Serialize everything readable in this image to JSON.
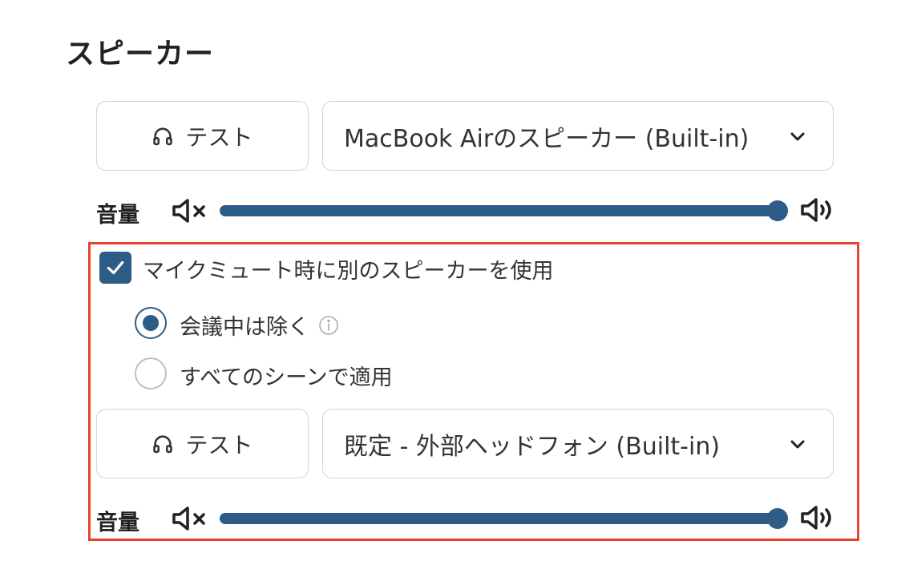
{
  "section": {
    "title": "スピーカー"
  },
  "primary": {
    "test_label": "テスト",
    "device": "MacBook Airのスピーカー (Built-in)",
    "volume_label": "音量",
    "volume_level": 1.0
  },
  "alt_speaker": {
    "checkbox_label": "マイクミュート時に別のスピーカーを使用",
    "checked": true,
    "options": [
      {
        "label": "会議中は除く",
        "selected": true
      },
      {
        "label": "すべてのシーンで適用",
        "selected": false
      }
    ],
    "test_label": "テスト",
    "device": "既定 - 外部ヘッドフォン (Built-in)",
    "volume_label": "音量",
    "volume_level": 1.0
  },
  "colors": {
    "accent": "#2d5d86",
    "highlight": "#e5432a",
    "border": "#d4d4d4"
  },
  "icons": [
    "headphones-icon",
    "chevron-down-icon",
    "speaker-mute-icon",
    "speaker-volume-icon",
    "checkmark-icon",
    "info-icon"
  ]
}
